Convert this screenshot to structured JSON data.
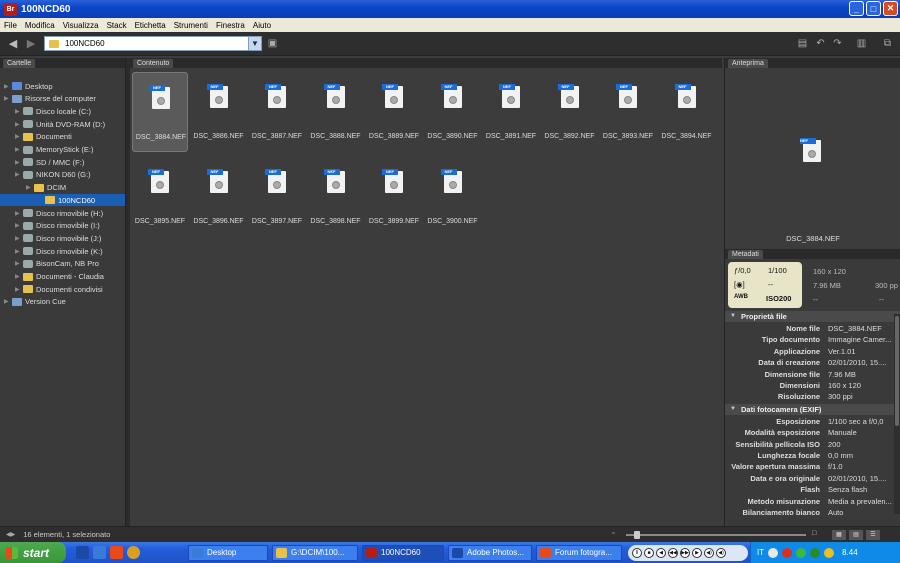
{
  "window": {
    "title": "100NCD60",
    "app_icon": "Br"
  },
  "menu": [
    "File",
    "Modifica",
    "Visualizza",
    "Stack",
    "Etichetta",
    "Strumenti",
    "Finestra",
    "Aiuto"
  ],
  "toolbar": {
    "path": "100NCD60"
  },
  "left_panel": {
    "tab": "Cartelle",
    "items": [
      {
        "label": "Desktop",
        "icon": "desktop-icon",
        "level": 0
      },
      {
        "label": "Risorse del computer",
        "icon": "computer-icon",
        "level": 0
      },
      {
        "label": "Disco locale (C:)",
        "icon": "drive-icon",
        "level": 1
      },
      {
        "label": "Unità DVD-RAM (D:)",
        "icon": "dvd-icon",
        "level": 1
      },
      {
        "label": "Documenti",
        "icon": "folder-icon",
        "level": 1
      },
      {
        "label": "MemoryStick (E:)",
        "icon": "drive-icon",
        "level": 1
      },
      {
        "label": "SD / MMC (F:)",
        "icon": "drive-icon",
        "level": 1
      },
      {
        "label": "NIKON D60 (G:)",
        "icon": "drive-icon",
        "level": 1
      },
      {
        "label": "DCIM",
        "icon": "folder-icon",
        "level": 2
      },
      {
        "label": "100NCD60",
        "icon": "folder-icon",
        "level": 3,
        "selected": true
      },
      {
        "label": "Disco rimovibile (H:)",
        "icon": "drive-icon",
        "level": 1
      },
      {
        "label": "Disco rimovibile (I:)",
        "icon": "drive-icon",
        "level": 1
      },
      {
        "label": "Disco rimovibile (J:)",
        "icon": "drive-icon",
        "level": 1
      },
      {
        "label": "Disco rimovibile (K:)",
        "icon": "drive-icon",
        "level": 1
      },
      {
        "label": "BisonCam, NB Pro",
        "icon": "camera-icon",
        "level": 1
      },
      {
        "label": "Documenti - Claudia",
        "icon": "folder-icon",
        "level": 1
      },
      {
        "label": "Documenti condivisi",
        "icon": "folder-icon",
        "level": 1
      },
      {
        "label": "Version Cue",
        "icon": "version-cue-icon",
        "level": 0
      }
    ]
  },
  "content": {
    "tab": "Contenuto",
    "files": [
      "DSC_3884.NEF",
      "DSC_3886.NEF",
      "DSC_3887.NEF",
      "DSC_3888.NEF",
      "DSC_3889.NEF",
      "DSC_3890.NEF",
      "DSC_3891.NEF",
      "DSC_3892.NEF",
      "DSC_3893.NEF",
      "DSC_3894.NEF",
      "DSC_3895.NEF",
      "DSC_3896.NEF",
      "DSC_3897.NEF",
      "DSC_3898.NEF",
      "DSC_3899.NEF",
      "DSC_3900.NEF"
    ],
    "badge": "NEF"
  },
  "preview": {
    "tab": "Anteprima",
    "filename": "DSC_3884.NEF"
  },
  "metadata": {
    "tab": "Metadati",
    "card": {
      "aperture": "ƒ/0,0",
      "shutter": "1/100",
      "metering": "--",
      "wb": "AWB",
      "iso": "ISO200"
    },
    "summary": {
      "dims": "160 x 120",
      "size": "7.96 MB",
      "res": "300 pp",
      "d1": "--",
      "d2": "--"
    },
    "sections": [
      {
        "title": "Proprietà file",
        "rows": [
          {
            "k": "Nome file",
            "v": "DSC_3884.NEF"
          },
          {
            "k": "Tipo documento",
            "v": "Immagine Camer..."
          },
          {
            "k": "Applicazione",
            "v": "Ver.1.01"
          },
          {
            "k": "Data di creazione",
            "v": "02/01/2010, 15...."
          },
          {
            "k": "Dimensione file",
            "v": "7.96 MB"
          },
          {
            "k": "Dimensioni",
            "v": "160 x 120"
          },
          {
            "k": "Risoluzione",
            "v": "300 ppi"
          }
        ]
      },
      {
        "title": "Dati fotocamera (EXIF)",
        "rows": [
          {
            "k": "Esposizione",
            "v": "1/100 sec a f/0,0"
          },
          {
            "k": "Modalità esposizione",
            "v": "Manuale"
          },
          {
            "k": "Sensibilità pellicola ISO",
            "v": "200"
          },
          {
            "k": "Lunghezza focale",
            "v": "0,0 mm"
          },
          {
            "k": "Valore apertura massima",
            "v": "f/1.0"
          },
          {
            "k": "Data e ora originale",
            "v": "02/01/2010, 15...."
          },
          {
            "k": "Flash",
            "v": "Senza flash"
          },
          {
            "k": "Metodo misurazione",
            "v": "Media a prevalen..."
          },
          {
            "k": "Bilanciamento bianco",
            "v": "Auto"
          }
        ]
      }
    ]
  },
  "status": {
    "text": "16 elementi, 1 selezionato"
  },
  "taskbar": {
    "start": "start",
    "tasks": [
      {
        "label": "Desktop",
        "color": "#3a7ad8"
      },
      {
        "label": "G:\\DCIM\\100...",
        "color": "#e8c14a"
      },
      {
        "label": "100NCD60",
        "color": "#b41e14",
        "active": true
      },
      {
        "label": "Adobe Photos...",
        "color": "#1a4aa8"
      },
      {
        "label": "Forum fotogra...",
        "color": "#e84a1a"
      }
    ],
    "media_icons": [
      "II",
      "■",
      "◀",
      "◀◀",
      "▶▶",
      "▶",
      "◀)",
      "◀)"
    ],
    "tray_lang": "IT",
    "clock": "8.44"
  }
}
